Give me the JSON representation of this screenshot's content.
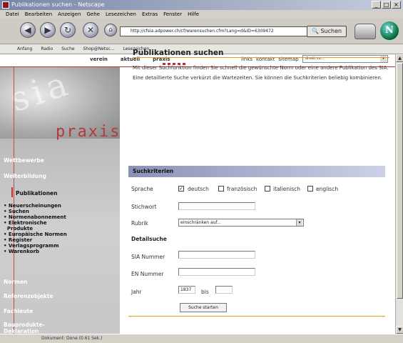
{
  "window": {
    "title": "Publikationen suchen - Netscape",
    "buttons": [
      "_",
      "□",
      "×"
    ]
  },
  "menubar": [
    "Datei",
    "Bearbeiten",
    "Anzeigen",
    "Gehe",
    "Lesezeichen",
    "Extras",
    "Fenster",
    "Hilfe"
  ],
  "navbar": {
    "url": "http://cfsia.adpower.ch/cf/warensuchen.cfm?Lang=d&ID=6309472",
    "search_label": "Suchen"
  },
  "personal_toolbar": [
    "Anfang",
    "Radio",
    "Suche",
    "Shop@Netsc...",
    "Lesezeichen"
  ],
  "site": {
    "topnav": [
      "verein",
      "aktuell",
      "praxis"
    ],
    "utilnav": [
      "links",
      "kontakt",
      "sitemap"
    ],
    "direkt_placeholder": "direkt zu...",
    "logo_text": "praxis",
    "logo_bg_text": "sia",
    "sidebar": {
      "items": [
        "Wettbewerbe",
        "Weiterbildung",
        "Publikationen"
      ],
      "sub_items": [
        "• Neuerscheinungen",
        "• Suchen",
        "• Normenabonnement",
        "• Elektronische",
        "  Produkte",
        "• Europäische Normen",
        "• Register",
        "• Verlagsprogramm",
        "• Warenkorb"
      ],
      "lower_items": [
        "Normen",
        "Referenzobjekte",
        "Fachleute",
        "Bauprodukte-",
        "Deklaration"
      ]
    },
    "heading": "Publikationen suchen",
    "intro": "Mit dieser Suchfunktion finden Sie schnell die gewünschte Norm oder eine andere Publikation des SIA. Eine detaillierte Suche verkürzt die Wartezeiten. Sie können die Suchkriterien beliebig kombinieren.",
    "section_title": "Suchkriterien",
    "form": {
      "sprache_label": "Sprache",
      "languages": [
        {
          "label": "deutsch",
          "checked": true
        },
        {
          "label": "französisch",
          "checked": false
        },
        {
          "label": "italienisch",
          "checked": false
        },
        {
          "label": "englisch",
          "checked": false
        }
      ],
      "stichwort_label": "Stichwort",
      "rubrik_label": "Rubrik",
      "rubrik_value": "einschränken auf...",
      "detail_heading": "Detailsuche",
      "sia_label": "SIA Nummer",
      "en_label": "EN Nummer",
      "jahr_label": "Jahr",
      "jahr_from": "1837",
      "jahr_bis_label": "bis",
      "submit_label": "Suche starten"
    }
  },
  "status": "Dokument: Done (0.61 Sek.)"
}
